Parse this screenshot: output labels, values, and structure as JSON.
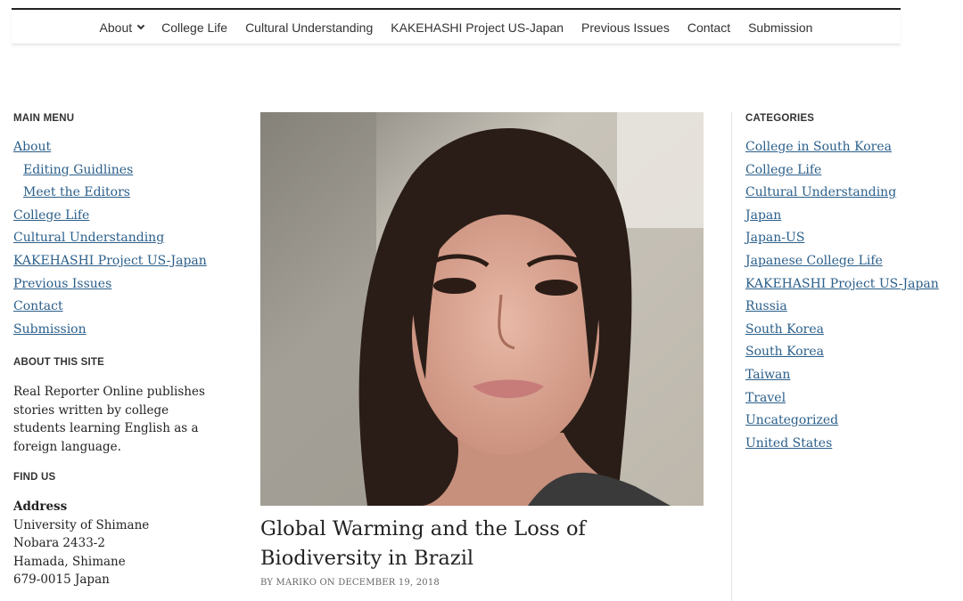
{
  "header": {
    "nav": [
      {
        "label": "About",
        "has_dropdown": true
      },
      {
        "label": "College Life"
      },
      {
        "label": "Cultural Understanding"
      },
      {
        "label": "KAKEHASHI Project US-Japan"
      },
      {
        "label": "Previous Issues"
      },
      {
        "label": "Contact"
      },
      {
        "label": "Submission"
      }
    ]
  },
  "left_sidebar": {
    "main_menu_title": "MAIN MENU",
    "main_menu": [
      {
        "label": "About",
        "sub": false
      },
      {
        "label": "Editing Guidlines",
        "sub": true
      },
      {
        "label": "Meet the Editors",
        "sub": true
      },
      {
        "label": "College Life",
        "sub": false
      },
      {
        "label": "Cultural Understanding",
        "sub": false
      },
      {
        "label": "KAKEHASHI Project US-Japan",
        "sub": false
      },
      {
        "label": "Previous Issues",
        "sub": false
      },
      {
        "label": "Contact",
        "sub": false
      },
      {
        "label": "Submission",
        "sub": false
      }
    ],
    "about_title": "ABOUT THIS SITE",
    "about_text": "Real Reporter Online publishes stories written by college students learning English as a foreign language.",
    "find_title": "FIND US",
    "address_label": "Address",
    "address_lines": [
      "University of Shimane",
      "Nobara 2433-2",
      "Hamada, Shimane",
      "679-0015 Japan"
    ]
  },
  "post": {
    "title": "Global Warming and the Loss of Biodiversity in Brazil",
    "byline": "BY MARIKO ON DECEMBER 19, 2018"
  },
  "right_sidebar": {
    "categories_title": "CATEGORIES",
    "categories": [
      "College in South Korea",
      "College Life",
      "Cultural Understanding",
      "Japan",
      "Japan-US",
      "Japanese College Life",
      "KAKEHASHI Project US-Japan",
      "Russia",
      "South Korea",
      "South Korea",
      "Taiwan",
      "Travel",
      "Uncategorized",
      "United States"
    ]
  },
  "colors": {
    "link": "#2b5f8a",
    "text": "#222222",
    "rule": "#222222"
  }
}
